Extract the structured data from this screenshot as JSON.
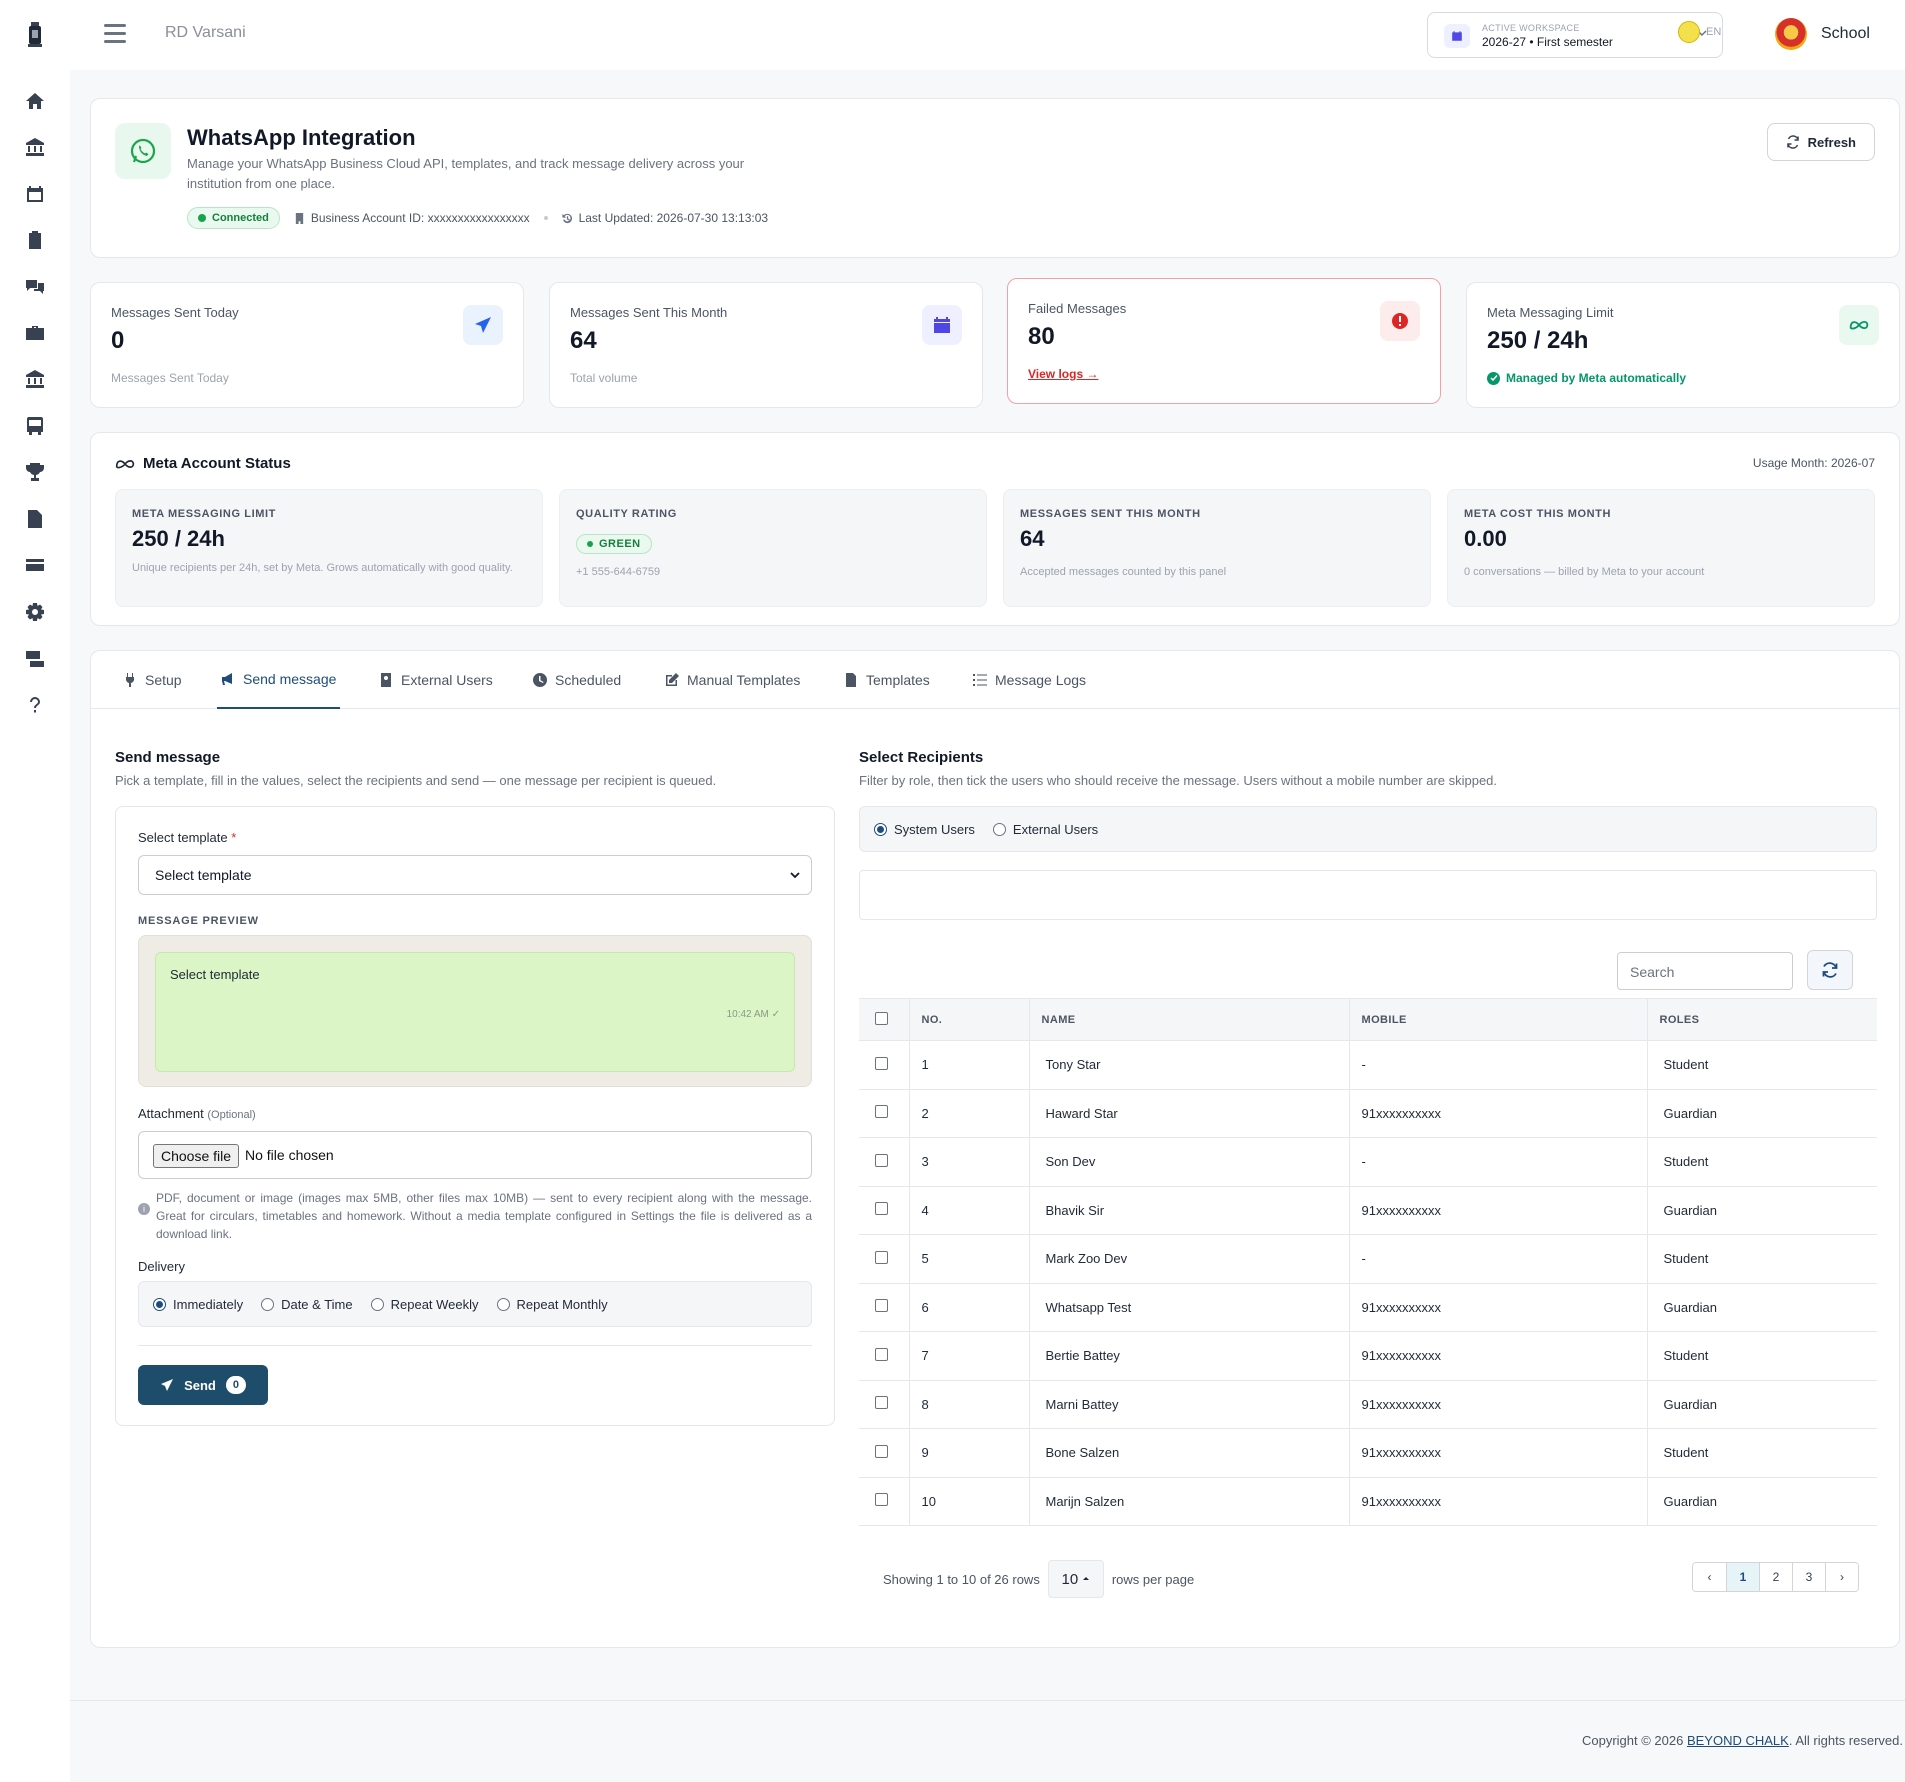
{
  "topbar": {
    "brand": "RD Varsani",
    "workspace_label": "ACTIVE WORKSPACE",
    "workspace_value": "2026-27 • First semester",
    "language": "EN",
    "school_name": "School"
  },
  "sidebar": {
    "items": [
      "home-icon",
      "institution-icon",
      "calendar-icon",
      "clipboard-icon",
      "chat-icon",
      "briefcase-icon",
      "bank-icon",
      "bus-icon",
      "trophy-icon",
      "document-icon",
      "card-icon",
      "gear-icon",
      "billing-icon",
      "help-icon"
    ]
  },
  "header": {
    "title": "WhatsApp Integration",
    "description": "Manage your WhatsApp Business Cloud API, templates, and track message delivery across your institution from one place.",
    "status": "Connected",
    "business_account": "Business Account ID: xxxxxxxxxxxxxxxxx",
    "last_updated": "Last Updated: 2026-07-30 13:13:03",
    "refresh_label": "Refresh"
  },
  "stats": [
    {
      "label": "Messages Sent Today",
      "value": "0",
      "sub": "Messages Sent Today"
    },
    {
      "label": "Messages Sent This Month",
      "value": "64",
      "sub": "Total volume"
    },
    {
      "label": "Failed Messages",
      "value": "80",
      "link": "View logs →"
    },
    {
      "label": "Meta Messaging Limit",
      "value": "250 / 24h",
      "sub": "Managed by Meta automatically"
    }
  ],
  "meta_status": {
    "title": "Meta Account Status",
    "usage_month": "Usage Month: 2026-07",
    "boxes": [
      {
        "key": "META MESSAGING LIMIT",
        "value": "250 / 24h",
        "desc": "Unique recipients per 24h, set by Meta. Grows automatically with good quality."
      },
      {
        "key": "QUALITY RATING",
        "badge": "GREEN",
        "desc": "+1 555-644-6759"
      },
      {
        "key": "MESSAGES SENT THIS MONTH",
        "value": "64",
        "desc": "Accepted messages counted by this panel"
      },
      {
        "key": "META COST THIS MONTH",
        "value": "0.00",
        "desc": "0 conversations — billed by Meta to your account"
      }
    ]
  },
  "tabs": [
    "Setup",
    "Send message",
    "External Users",
    "Scheduled",
    "Manual Templates",
    "Templates",
    "Message Logs"
  ],
  "send": {
    "title": "Send message",
    "desc": "Pick a template, fill in the values, select the recipients and send — one message per recipient is queued.",
    "template_label": "Select template",
    "template_required": "*",
    "template_value": "Select template",
    "preview_label": "MESSAGE PREVIEW",
    "preview_text": "Select template",
    "preview_time": "10:42 AM ✓",
    "attachment_label": "Attachment",
    "attachment_optional": "(Optional)",
    "choose_file": "Choose file",
    "no_file": "No file chosen",
    "help": "PDF, document or image (images max 5MB, other files max 10MB) — sent to every recipient along with the message. Great for circulars, timetables and homework. Without a media template configured in Settings the file is delivered as a download link.",
    "delivery_label": "Delivery",
    "delivery_options": [
      "Immediately",
      "Date & Time",
      "Repeat Weekly",
      "Repeat Monthly"
    ],
    "delivery_selected": "Immediately",
    "send_label": "Send",
    "send_count": "0"
  },
  "recipients": {
    "title": "Select Recipients",
    "desc": "Filter by role, then tick the users who should receive the message. Users without a mobile number are skipped.",
    "types": [
      "System Users",
      "External Users"
    ],
    "type_selected": "System Users",
    "search_placeholder": "Search",
    "columns": [
      "NO.",
      "NAME",
      "MOBILE",
      "ROLES"
    ],
    "rows": [
      {
        "no": "1",
        "name": "Tony Star",
        "mobile": "-",
        "role": "Student"
      },
      {
        "no": "2",
        "name": "Haward Star",
        "mobile": "91xxxxxxxxxx",
        "role": "Guardian"
      },
      {
        "no": "3",
        "name": "Son Dev",
        "mobile": "-",
        "role": "Student"
      },
      {
        "no": "4",
        "name": "Bhavik Sir",
        "mobile": "91xxxxxxxxxx",
        "role": "Guardian"
      },
      {
        "no": "5",
        "name": "Mark Zoo Dev",
        "mobile": "-",
        "role": "Student"
      },
      {
        "no": "6",
        "name": "Whatsapp Test",
        "mobile": "91xxxxxxxxxx",
        "role": "Guardian"
      },
      {
        "no": "7",
        "name": "Bertie Battey",
        "mobile": "91xxxxxxxxxx",
        "role": "Student"
      },
      {
        "no": "8",
        "name": "Marni Battey",
        "mobile": "91xxxxxxxxxx",
        "role": "Guardian"
      },
      {
        "no": "9",
        "name": "Bone Salzen",
        "mobile": "91xxxxxxxxxx",
        "role": "Student"
      },
      {
        "no": "10",
        "name": "Marijn Salzen",
        "mobile": "91xxxxxxxxxx",
        "role": "Guardian"
      }
    ],
    "showing": "Showing 1 to 10 of 26 rows",
    "rows_per_page": "10",
    "rows_per_page_label": "rows per page",
    "pages": [
      "‹",
      "1",
      "2",
      "3",
      "›"
    ],
    "current_page": "1"
  },
  "footer": {
    "prefix": "Copyright © 2026 ",
    "link": "BEYOND CHALK",
    "suffix": ". All rights reserved."
  },
  "colors": {
    "primary": "#1e4d7b",
    "whatsapp": "#25d366",
    "danger": "#dc2626",
    "success": "#059669"
  }
}
